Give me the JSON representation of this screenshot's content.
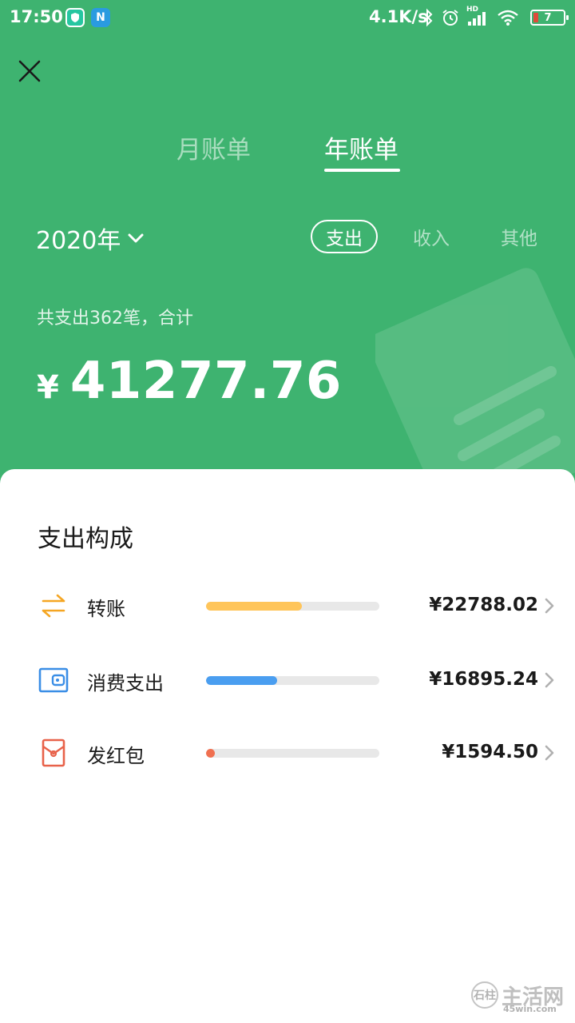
{
  "status_bar": {
    "time": "17:50",
    "app1_glyph": "shield-icon",
    "app2_label": "N",
    "net_speed": "4.1K/s",
    "hd_label": "HD",
    "battery": "7"
  },
  "header": {
    "close_icon": "close-icon"
  },
  "tabs": {
    "month": "月账单",
    "year": "年账单",
    "active": "year"
  },
  "filter": {
    "year": "2020年",
    "types": [
      "支出",
      "收入",
      "其他"
    ],
    "active_type": "支出"
  },
  "summary": {
    "text": "共支出362笔，合计",
    "currency": "¥",
    "amount": "41277.76"
  },
  "composition": {
    "title": "支出构成",
    "items": [
      {
        "label": "转账",
        "amount": "¥22788.02",
        "fraction": 0.552,
        "color": "#ffc55a",
        "icon": "transfer-icon"
      },
      {
        "label": "消费支出",
        "amount": "¥16895.24",
        "fraction": 0.409,
        "color": "#4a9ef0",
        "icon": "wallet-icon"
      },
      {
        "label": "发红包",
        "amount": "¥1594.50",
        "fraction": 0.039,
        "color": "#f07050",
        "icon": "red-packet-icon"
      }
    ]
  },
  "watermark": {
    "main": "主活网",
    "sub": "45win.com",
    "badge": "石柱"
  },
  "colors": {
    "brand_green": "#3eb370"
  }
}
